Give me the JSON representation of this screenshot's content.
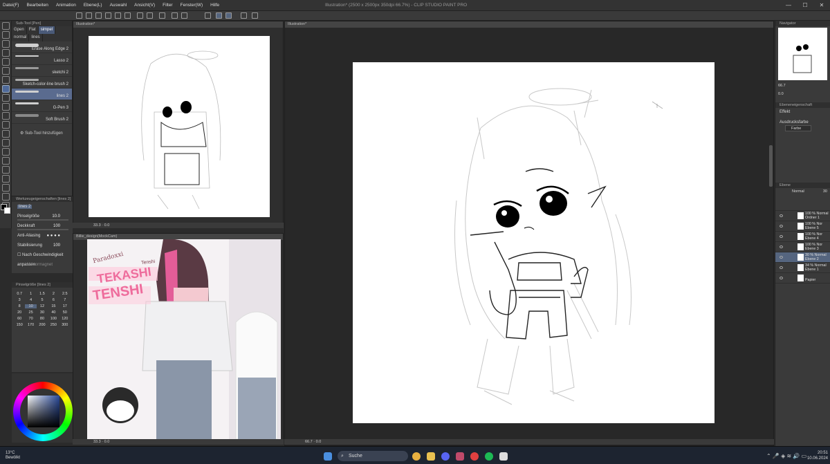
{
  "menu": [
    "Datei(F)",
    "Bearbeiten",
    "Animation",
    "Ebene(L)",
    "Auswahl",
    "Ansicht(V)",
    "Filter",
    "Fenster(W)",
    "Hilfe"
  ],
  "window_title": "Illustration* (2500 x 2500px 350dpi 66.7%) - CLIP STUDIO PAINT PRO",
  "subtool": {
    "title": "Sub-Tool [Pen]",
    "tabs": [
      "Gpen",
      "Flat",
      "simpel"
    ],
    "tabs2": [
      "normal",
      "lines"
    ],
    "brushes": [
      "Erase Along Edge 2",
      "Lasso 2",
      "sketchi 2",
      "Sketch-color-line brush 2",
      "lines 2",
      "G-Pen 3",
      "Soft Brush 2"
    ],
    "add_label": "Sub-Tool hinzufügen"
  },
  "tool_props": {
    "title": "Werkzeugeigenschaften [lines 2]",
    "tab": "lines 2",
    "rows": [
      {
        "label": "Pinselgröße",
        "value": "10.0"
      },
      {
        "label": "Deckkraft",
        "value": "100"
      },
      {
        "label": "Anti-Aliasing",
        "value": ""
      },
      {
        "label": "Stabilisierung",
        "value": "100"
      },
      {
        "label": "Nach Geschwindigkeit anpassen",
        "value": ""
      }
    ],
    "vektor": "Vektormagnet"
  },
  "brush_size": {
    "title": "Pinselgröße [lines 2]",
    "sizes": [
      "0.7",
      "1",
      "1.5",
      "2",
      "2.5",
      "3",
      "4",
      "5",
      "6",
      "7",
      "8",
      "10",
      "12",
      "15",
      "17",
      "20",
      "25",
      "30",
      "40",
      "50",
      "60",
      "70",
      "80",
      "100",
      "120",
      "150",
      "170",
      "200",
      "250",
      "300"
    ]
  },
  "docs": {
    "top_tab": "Illustration*",
    "bottom_tab": "Billie_design(MockCam)",
    "main_tab": "Illustration*",
    "top_zoom": "33.3",
    "bottom_zoom": "33.3",
    "main_zoom": "66.7",
    "angle": "0.0"
  },
  "ref_text": {
    "name1": "Paradoxxi",
    "name2": "TEKASHI",
    "name3": "TENSHI",
    "note": "Tenshi"
  },
  "navigator": {
    "title": "Navigator",
    "zoom": "66.7",
    "angle": "0.0"
  },
  "effect": {
    "title": "Ebeneneigenschaft",
    "effekt": "Effekt",
    "ausdruck": "Ausdrucksfarbe",
    "farbe": "Farbe"
  },
  "layers": {
    "title": "Ebene",
    "blend": "Normal",
    "opacity": "30",
    "items": [
      {
        "line1": "100 % Normal",
        "line2": "Ordner 1",
        "sel": false
      },
      {
        "line1": "100 % Nor",
        "line2": "Ebene 5",
        "sel": false
      },
      {
        "line1": "100 % Nor",
        "line2": "Ebene 4",
        "sel": false
      },
      {
        "line1": "100 % Nor",
        "line2": "Ebene 3",
        "sel": false
      },
      {
        "line1": "30 % Normal",
        "line2": "Ebene 2",
        "sel": true
      },
      {
        "line1": "34 % Normal",
        "line2": "Ebene 1",
        "sel": false
      },
      {
        "line1": "",
        "line2": "Papier",
        "sel": false
      }
    ]
  },
  "taskbar": {
    "weather_temp": "13°C",
    "weather_desc": "Bewölkt",
    "search": "Suche",
    "time": "20:51",
    "date": "10.06.2024"
  },
  "colors": {
    "accent": "#55657f"
  }
}
